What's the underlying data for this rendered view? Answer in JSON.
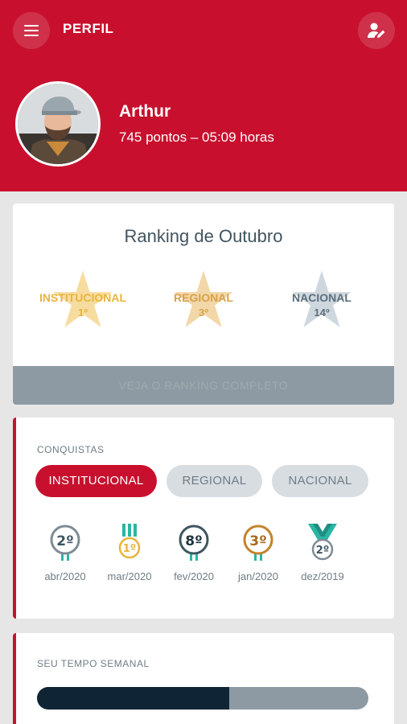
{
  "header": {
    "title": "PERFIL",
    "menu_icon": "hamburger-menu-icon",
    "edit_icon": "edit-profile-icon"
  },
  "profile": {
    "name": "Arthur",
    "stats": "745 pontos – 05:09 horas"
  },
  "ranking": {
    "title": "Ranking de Outubro",
    "items": [
      {
        "label": "INSTITUCIONAL",
        "position": "1º",
        "star_color": "#f7dca0",
        "text_color": "#e8b43c"
      },
      {
        "label": "REGIONAL",
        "position": "3º",
        "star_color": "#f2d7a8",
        "text_color": "#d9a24a"
      },
      {
        "label": "NACIONAL",
        "position": "14º",
        "star_color": "#cfd7de",
        "text_color": "#5b6f7c"
      }
    ],
    "full_button": "VEJA O RANKING COMPLETO"
  },
  "conquistas": {
    "title": "CONQUISTAS",
    "tabs": [
      "INSTITUCIONAL",
      "REGIONAL",
      "NACIONAL"
    ],
    "active_tab": "INSTITUCIONAL",
    "medals": [
      {
        "place": "2º",
        "date": "abr/2020",
        "color": "#7f8c94",
        "ribbon": "#2ab5a5"
      },
      {
        "place": "1º",
        "date": "mar/2020",
        "color": "#e8b43c",
        "ribbon": "#2ab5a5"
      },
      {
        "place": "8º",
        "date": "fev/2020",
        "color": "#3e5661",
        "ribbon": "#2ab5a5"
      },
      {
        "place": "3º",
        "date": "jan/2020",
        "color": "#c4822a",
        "ribbon": "#2ab5a5"
      },
      {
        "place": "2º",
        "date": "dez/2019",
        "color": "#7f8c94",
        "ribbon": "#2ab5a5"
      }
    ]
  },
  "tempo": {
    "title": "SEU TEMPO SEMANAL",
    "progress": 0.58
  },
  "colors": {
    "brand": "#c8102e",
    "dark": "#0f2536",
    "grey": "#8e9aa3"
  }
}
